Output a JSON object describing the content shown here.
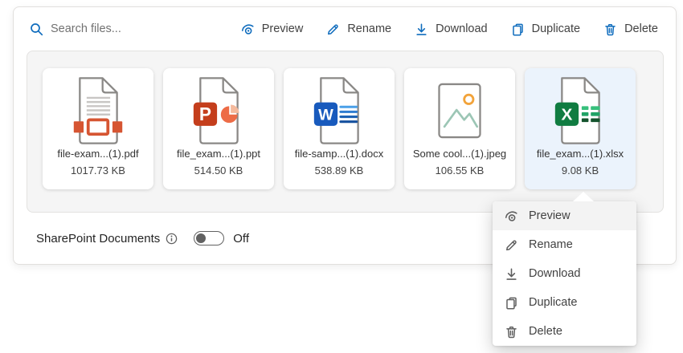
{
  "search": {
    "placeholder": "Search files...",
    "icon": "search-icon"
  },
  "toolbar": {
    "buttons": [
      {
        "label": "Preview",
        "icon": "preview-icon"
      },
      {
        "label": "Rename",
        "icon": "rename-icon"
      },
      {
        "label": "Download",
        "icon": "download-icon"
      },
      {
        "label": "Duplicate",
        "icon": "duplicate-icon"
      },
      {
        "label": "Delete",
        "icon": "delete-icon"
      }
    ]
  },
  "files": [
    {
      "name": "file-exam...(1).pdf",
      "size": "1017.73 KB",
      "type": "pdf",
      "icon": "pdf-file-icon",
      "selected": false
    },
    {
      "name": "file_exam...(1).ppt",
      "size": "514.50 KB",
      "type": "ppt",
      "icon": "powerpoint-file-icon",
      "selected": false
    },
    {
      "name": "file-samp...(1).docx",
      "size": "538.89 KB",
      "type": "docx",
      "icon": "word-file-icon",
      "selected": false
    },
    {
      "name": "Some cool...(1).jpeg",
      "size": "106.55 KB",
      "type": "jpeg",
      "icon": "image-file-icon",
      "selected": false
    },
    {
      "name": "file_exam...(1).xlsx",
      "size": "9.08 KB",
      "type": "xlsx",
      "icon": "excel-file-icon",
      "selected": true
    }
  ],
  "context_menu": {
    "highlighted": "Preview",
    "items": [
      {
        "label": "Preview",
        "icon": "preview-icon"
      },
      {
        "label": "Rename",
        "icon": "rename-icon"
      },
      {
        "label": "Download",
        "icon": "download-icon"
      },
      {
        "label": "Duplicate",
        "icon": "duplicate-icon"
      },
      {
        "label": "Delete",
        "icon": "delete-icon"
      }
    ]
  },
  "footer": {
    "label": "SharePoint Documents",
    "info_icon": "info-icon",
    "toggle_state": "Off"
  },
  "colors": {
    "brand_blue": "#0f6cbd",
    "selected_card_bg": "#ebf3fc",
    "container_bg": "#f5f5f5",
    "menu_highlight": "#f3f3f3",
    "pdf_red": "#d65532",
    "ppt_orange": "#c43e1c",
    "word_blue": "#185abd",
    "excel_green": "#107c41",
    "image_teal": "#9cc6b5",
    "image_sun_orange": "#f2a33a",
    "doc_outline_gray": "#8a8886"
  }
}
